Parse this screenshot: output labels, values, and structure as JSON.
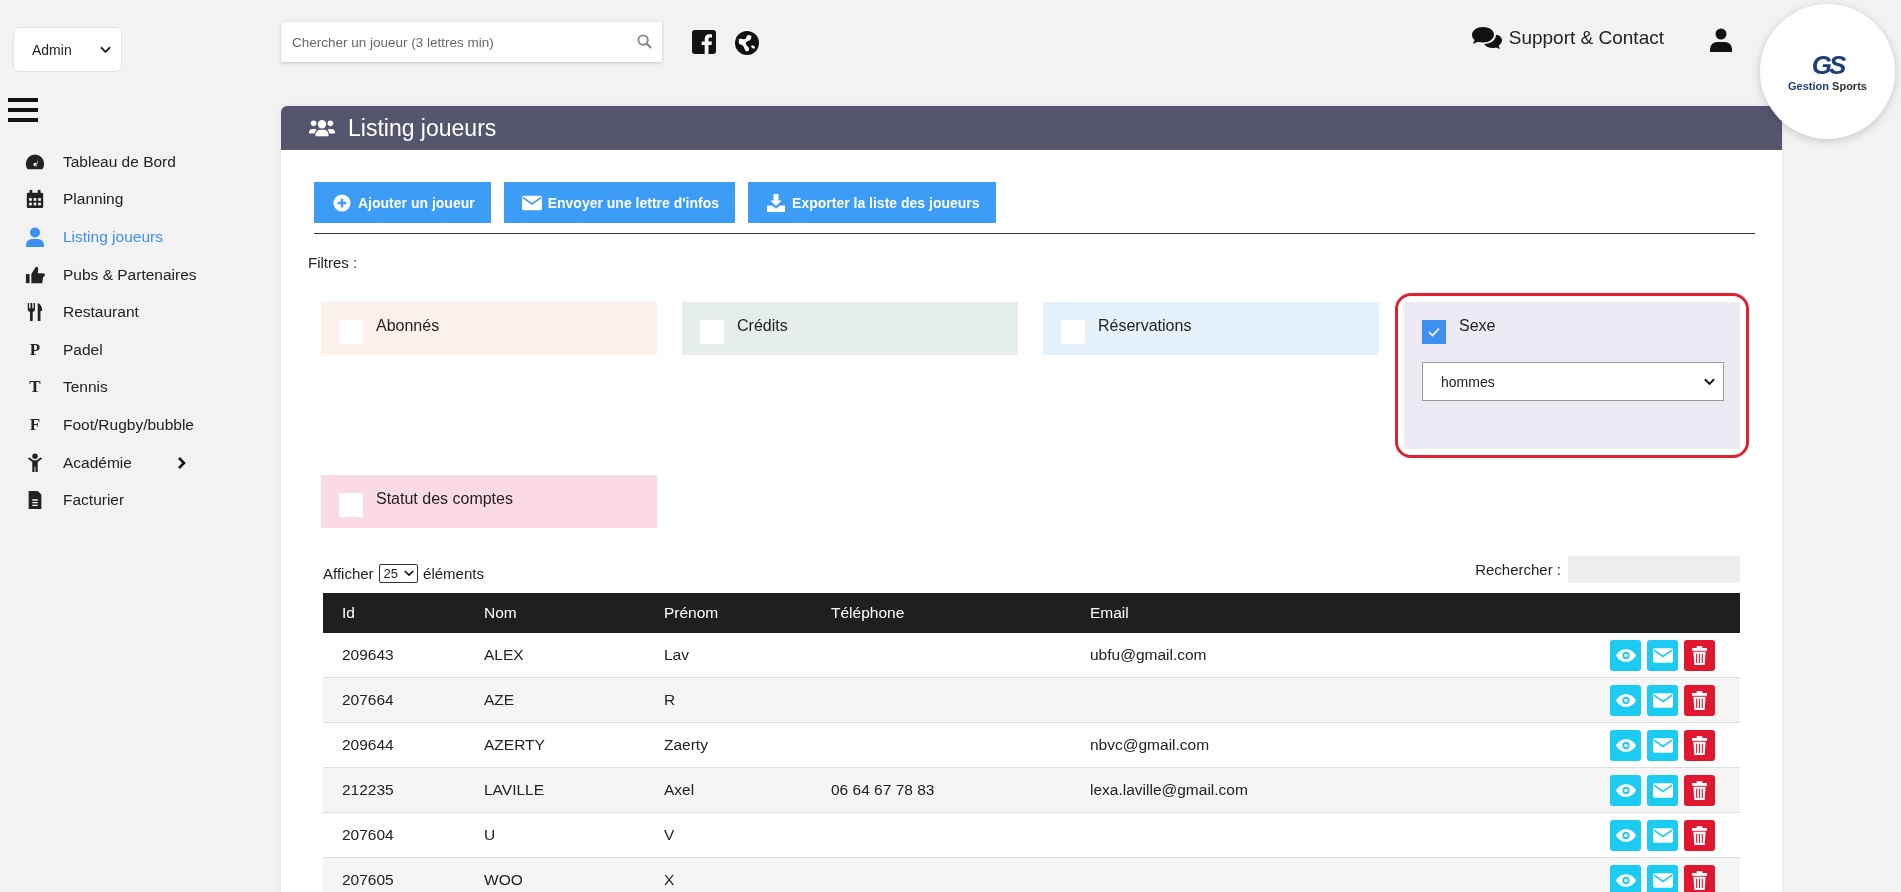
{
  "role_select": {
    "value": "Admin"
  },
  "sidebar": {
    "items": [
      {
        "label": "Tableau de Bord",
        "kind": "gauge",
        "selected": false,
        "expandable": false
      },
      {
        "label": "Planning",
        "kind": "calendar",
        "selected": false,
        "expandable": false
      },
      {
        "label": "Listing joueurs",
        "kind": "user",
        "selected": true,
        "expandable": false
      },
      {
        "label": "Pubs & Partenaires",
        "kind": "thumb",
        "selected": false,
        "expandable": false
      },
      {
        "label": "Restaurant",
        "kind": "cutlery",
        "selected": false,
        "expandable": false
      },
      {
        "label": "Padel",
        "kind": "letter",
        "glyph": "P",
        "selected": false,
        "expandable": false
      },
      {
        "label": "Tennis",
        "kind": "letter",
        "glyph": "T",
        "selected": false,
        "expandable": false
      },
      {
        "label": "Foot/Rugby/bubble",
        "kind": "letter",
        "glyph": "F",
        "selected": false,
        "expandable": false
      },
      {
        "label": "Académie",
        "kind": "person",
        "selected": false,
        "expandable": true
      },
      {
        "label": "Facturier",
        "kind": "invoice",
        "selected": false,
        "expandable": false
      }
    ]
  },
  "topbar": {
    "search": {
      "placeholder": "Chercher un joueur (3 lettres min)"
    },
    "support": "Support & Contact"
  },
  "logo": {
    "monogram": "GS",
    "word_1": "Gestion",
    "word_2": "Sports"
  },
  "panel": {
    "title": "Listing joueurs",
    "actions": [
      {
        "label": "Ajouter un joueur",
        "kind": "add"
      },
      {
        "label": "Envoyer une lettre d'infos",
        "kind": "mail"
      },
      {
        "label": "Exporter la liste des joueurs",
        "kind": "export"
      }
    ],
    "filters_label": "Filtres :",
    "filters": [
      {
        "label": "Abonnés",
        "checked": false,
        "color": "#fbf0ea",
        "highlighted": false
      },
      {
        "label": "Crédits",
        "checked": false,
        "color": "#e6eeeb",
        "highlighted": false
      },
      {
        "label": "Réservations",
        "checked": false,
        "color": "#e6f2fb",
        "highlighted": false
      },
      {
        "label": "Sexe",
        "checked": true,
        "color": "#eeeaf4",
        "highlighted": true,
        "select": {
          "value": "hommes"
        }
      },
      {
        "label": "Statut des comptes",
        "checked": false,
        "color": "#fadbe3",
        "highlighted": false
      }
    ],
    "table": {
      "length_before": "Afficher",
      "length_value": "25",
      "length_after": "éléments",
      "search_label": "Rechercher :",
      "columns": [
        "Id",
        "Nom",
        "Prénom",
        "Téléphone",
        "Email"
      ],
      "rows": [
        {
          "cells": [
            "209643",
            "ALEX",
            "Lav",
            "",
            "ubfu@gmail.com"
          ]
        },
        {
          "cells": [
            "207664",
            "AZE",
            "R",
            "",
            ""
          ]
        },
        {
          "cells": [
            "209644",
            "AZERTY",
            "Zaerty",
            "",
            "nbvc@gmail.com"
          ]
        },
        {
          "cells": [
            "212235",
            "LAVILLE",
            "Axel",
            "06 64 67 78 83",
            "lexa.laville@gmail.com"
          ]
        },
        {
          "cells": [
            "207604",
            "U",
            "V",
            "",
            ""
          ]
        },
        {
          "cells": [
            "207605",
            "WOO",
            "X",
            "",
            ""
          ]
        }
      ]
    }
  }
}
